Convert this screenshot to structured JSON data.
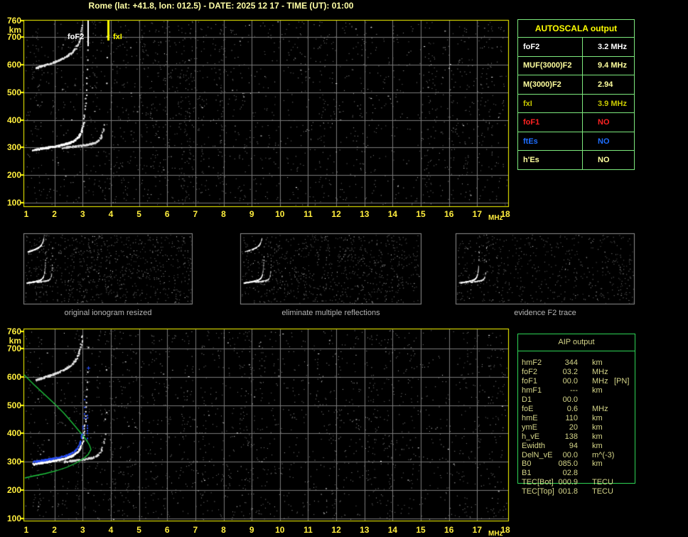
{
  "title": "Rome (lat: +41.8, lon: 012.5) - DATE: 2025 12 17 - TIME (UT): 01:00",
  "colors": {
    "axis_yellow": "#ffee3e",
    "grid_gray": "#7a7a7a",
    "trace_white": "#ffffff",
    "profile_green": "#1fc93e",
    "fit_blue": "#2b52ff",
    "table_border_light_green": "#7ce87c",
    "table_border_green": "#2ed455",
    "aip_text": "#d4d488",
    "caption_gray": "#b4b4b4"
  },
  "top_ionogram": {
    "x_unit": "MHz",
    "y_unit": "km",
    "x_ticks": [
      "1",
      "2",
      "3",
      "4",
      "5",
      "6",
      "7",
      "8",
      "9",
      "10",
      "11",
      "12",
      "13",
      "14",
      "15",
      "16",
      "17",
      "18"
    ],
    "y_ticks": [
      "760",
      "700",
      "600",
      "500",
      "400",
      "300",
      "200",
      "100"
    ],
    "freq_range_mhz": [
      1,
      18
    ],
    "height_range_km": [
      100,
      760
    ],
    "markers": {
      "foF2": {
        "label": "foF2",
        "mhz": 3.2,
        "color": "#ffffff"
      },
      "fxI": {
        "label": "fxI",
        "mhz": 3.9,
        "color": "#ffff00"
      }
    }
  },
  "bottom_ionogram": {
    "x_unit": "MHz",
    "y_unit": "km",
    "x_ticks": [
      "1",
      "2",
      "3",
      "4",
      "5",
      "6",
      "7",
      "8",
      "9",
      "10",
      "11",
      "12",
      "13",
      "14",
      "15",
      "16",
      "17",
      "18"
    ],
    "y_ticks": [
      "760",
      "700",
      "600",
      "500",
      "400",
      "300",
      "200",
      "100"
    ],
    "freq_range_mhz": [
      1,
      18
    ],
    "height_range_km": [
      100,
      760
    ],
    "profile_nose": {
      "mhz": 3.2,
      "km": 366
    }
  },
  "panels": [
    {
      "caption": "original ionogram resized"
    },
    {
      "caption": "eliminate multiple reflections"
    },
    {
      "caption": "evidence F2 trace"
    }
  ],
  "autoscala": {
    "title": "AUTOSCALA output",
    "rows": [
      {
        "label": "foF2",
        "value": "3.2 MHz",
        "color": "#ffffff"
      },
      {
        "label": "MUF(3000)F2",
        "value": "9.4 MHz",
        "color": "#ffff9e"
      },
      {
        "label": "M(3000)F2",
        "value": "2.94",
        "color": "#ffff9e"
      },
      {
        "label": "fxI",
        "value": "3.9 MHz",
        "color": "#c9c900"
      },
      {
        "label": "foF1",
        "value": "NO",
        "color": "#ff2222"
      },
      {
        "label": "ftEs",
        "value": "NO",
        "color": "#1e6eff"
      },
      {
        "label": "h'Es",
        "value": "NO",
        "color": "#ffff9e"
      }
    ]
  },
  "aip": {
    "title": "AIP output",
    "rows": [
      {
        "label": "hmF2",
        "value": "344",
        "unit": "km",
        "note": ""
      },
      {
        "label": "foF2",
        "value": "03.2",
        "unit": "MHz",
        "note": ""
      },
      {
        "label": "foF1",
        "value": "00.0",
        "unit": "MHz",
        "note": "[PN]"
      },
      {
        "label": "hmF1",
        "value": "---",
        "unit": "km",
        "note": ""
      },
      {
        "label": "D1",
        "value": "00.0",
        "unit": "",
        "note": ""
      },
      {
        "label": "foE",
        "value": "0.6",
        "unit": "MHz",
        "note": ""
      },
      {
        "label": "hmE",
        "value": "110",
        "unit": "km",
        "note": ""
      },
      {
        "label": "ymE",
        "value": "20",
        "unit": "km",
        "note": ""
      },
      {
        "label": "h_vE",
        "value": "138",
        "unit": "km",
        "note": ""
      },
      {
        "label": "Ewidth",
        "value": "94",
        "unit": "km",
        "note": ""
      },
      {
        "label": "DelN_vE",
        "value": "00.0",
        "unit": "m^(-3)",
        "note": ""
      },
      {
        "label": "B0",
        "value": "085.0",
        "unit": "km",
        "note": ""
      },
      {
        "label": "B1",
        "value": "02.8",
        "unit": "",
        "note": ""
      },
      {
        "label": "TEC[Bot]",
        "value": "000.9",
        "unit": "TECU",
        "note": ""
      },
      {
        "label": "TEC[Top]",
        "value": "001.8",
        "unit": "TECU",
        "note": ""
      }
    ]
  }
}
